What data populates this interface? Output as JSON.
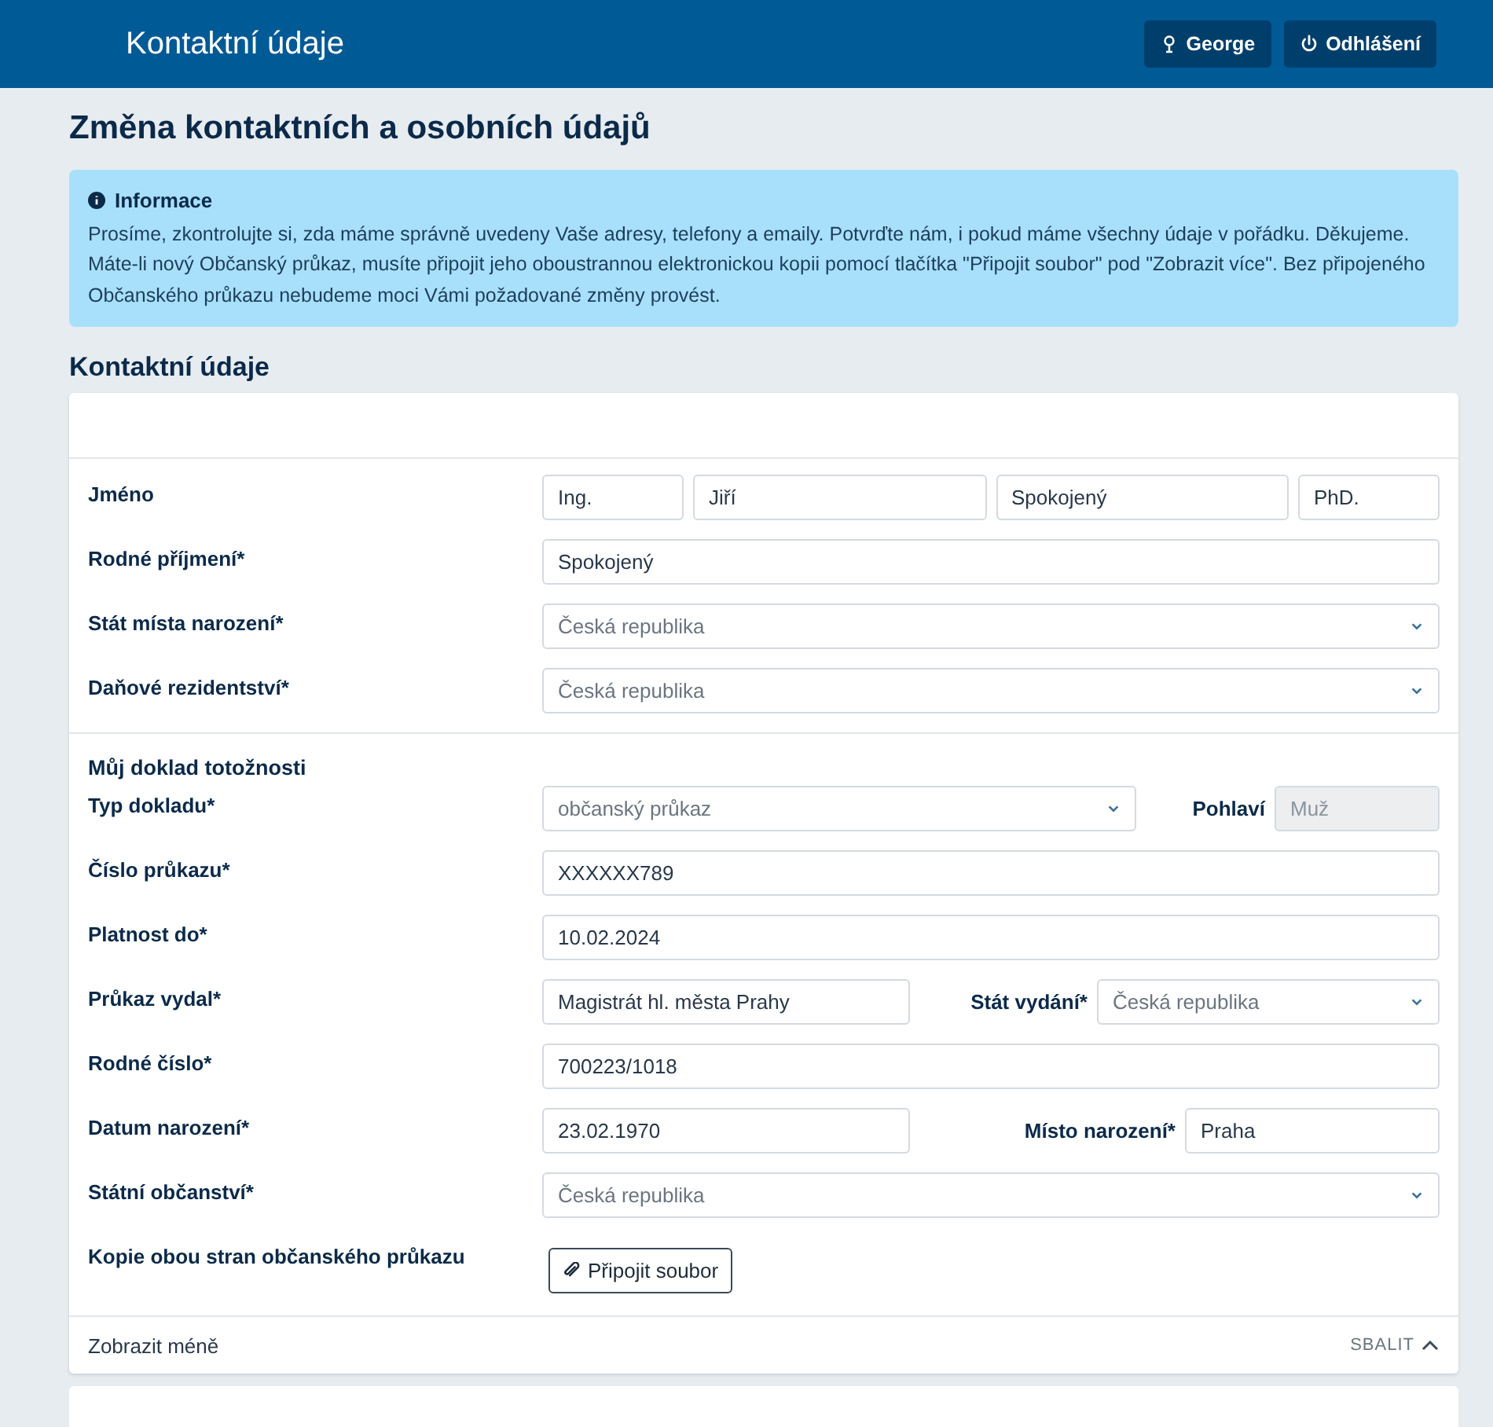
{
  "header": {
    "title": "Kontaktní údaje",
    "buttons": [
      {
        "kind": "user",
        "label": "George"
      },
      {
        "kind": "power",
        "label": "Odhlášení"
      }
    ]
  },
  "page_title": "Změna kontaktních a osobních údajů",
  "info": {
    "title": "Informace",
    "text": "Prosíme, zkontrolujte si, zda máme správně uvedeny Vaše adresy, telefony a emaily. Potvrďte nám, i pokud máme všechny údaje v pořádku. Děkujeme. Máte-li nový Občanský průkaz, musíte připojit jeho oboustrannou elektronickou kopii pomocí tlačítka \"Připojit soubor\" pod \"Zobrazit více\". Bez připojeného Občanského průkazu nebudeme moci Vámi požadované změny provést."
  },
  "section_title": "Kontaktní údaje",
  "groups": [
    {
      "rows": [
        {
          "kind": "name",
          "label": "Jméno",
          "fields": [
            {
              "kind": "input",
              "value": "Ing.",
              "disabled": false
            },
            {
              "kind": "input",
              "value": "Jiří",
              "disabled": false
            },
            {
              "kind": "input",
              "value": "Spokojený",
              "disabled": false
            },
            {
              "kind": "input",
              "value": "PhD.",
              "disabled": false
            }
          ]
        },
        {
          "kind": "single",
          "label": "Rodné příjmení*",
          "fields": [
            {
              "kind": "input",
              "value": "Spokojený",
              "disabled": false
            }
          ]
        },
        {
          "kind": "single",
          "label": "Stát místa narození*",
          "fields": [
            {
              "kind": "select",
              "value": "Česká republika"
            }
          ]
        },
        {
          "kind": "single",
          "label": "Daňové rezidentství*",
          "fields": [
            {
              "kind": "select",
              "value": "Česká republika"
            }
          ]
        }
      ]
    },
    {
      "title": "Můj doklad totožnosti",
      "rows": [
        {
          "kind": "pair",
          "label": "Typ dokladu*",
          "side_label": "Pohlaví",
          "fields": [
            {
              "kind": "select",
              "value": "občanský průkaz"
            },
            {
              "kind": "input",
              "value": "Muž",
              "disabled": true
            }
          ]
        },
        {
          "kind": "single",
          "label": "Číslo průkazu*",
          "fields": [
            {
              "kind": "input",
              "value": "XXXXXX789",
              "disabled": false
            }
          ]
        },
        {
          "kind": "single",
          "label": "Platnost do*",
          "fields": [
            {
              "kind": "input",
              "value": "10.02.2024",
              "disabled": false
            }
          ]
        },
        {
          "kind": "pair",
          "label": "Průkaz vydal*",
          "side_label": "Stát vydání*",
          "fields": [
            {
              "kind": "input",
              "value": "Magistrát hl. města Prahy",
              "disabled": false
            },
            {
              "kind": "select",
              "value": "Česká republika"
            }
          ]
        },
        {
          "kind": "single",
          "label": "Rodné číslo*",
          "fields": [
            {
              "kind": "input",
              "value": "700223/1018",
              "disabled": false
            }
          ]
        },
        {
          "kind": "pair",
          "label": "Datum narození*",
          "side_label": "Místo narození*",
          "fields": [
            {
              "kind": "input",
              "value": "23.02.1970",
              "disabled": false
            },
            {
              "kind": "input",
              "value": "Praha",
              "disabled": false
            }
          ]
        },
        {
          "kind": "single",
          "label": "Státní občanství*",
          "fields": [
            {
              "kind": "select",
              "value": "Česká republika"
            }
          ]
        },
        {
          "kind": "single",
          "label": "Kopie obou stran občanského průkazu",
          "fields": [
            {
              "kind": "button",
              "value": "Připojit soubor"
            }
          ]
        }
      ]
    }
  ],
  "footer": {
    "link": "Zobrazit méně",
    "collapse": "SBALIT"
  }
}
